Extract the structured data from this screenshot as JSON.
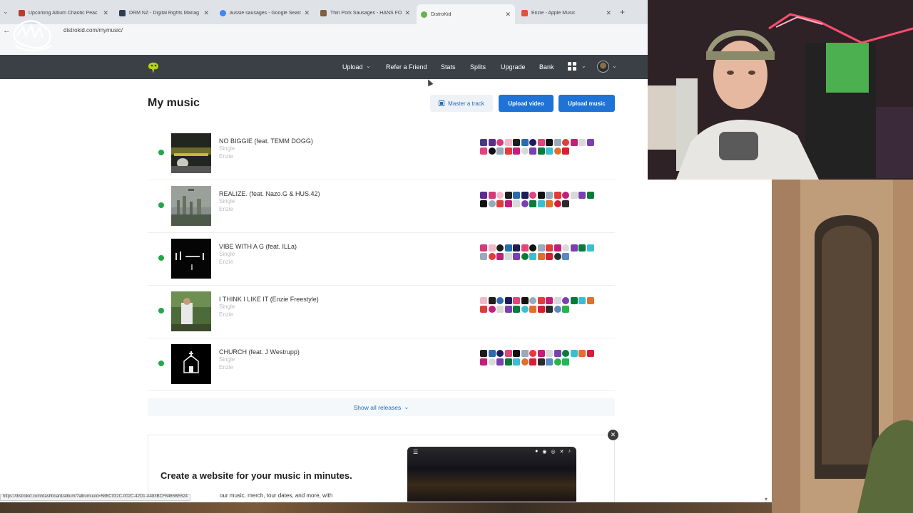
{
  "browser": {
    "tabs": [
      {
        "title": "Upcoming Album Chaotic Peac",
        "color": "#c0392b"
      },
      {
        "title": "DRM NZ - Digital Rights Manag",
        "color": "#2c3e50"
      },
      {
        "title": "aussie sausages - Google Searc",
        "color": "#4285f4"
      },
      {
        "title": "Thin Pork Sausages - HANS FO",
        "color": "#7f5f3f"
      },
      {
        "title": "DistroKid",
        "color": "#6ab04c"
      },
      {
        "title": "Enzie - Apple Music",
        "color": "#e74c3c"
      }
    ],
    "url": "distrokid.com/mymusic/",
    "status_url": "https://distrokid.com/dashboard/album/?albumuuid=58BC032C-002C-42D1-A483BCF8465BE624"
  },
  "nav": {
    "items": [
      "Upload",
      "Refer a Friend",
      "Stats",
      "Splits",
      "Upgrade",
      "Bank"
    ]
  },
  "main": {
    "title": "My music",
    "master_label": "Master a track",
    "upload_video_label": "Upload video",
    "upload_music_label": "Upload music",
    "show_all_label": "Show all releases",
    "releases": [
      {
        "title": "NO BIGGIE (feat. TEMM DOGG)",
        "type": "Single",
        "artist": "Enzie"
      },
      {
        "title": "REALIZE. (feat. Nazo.G & HUS.42)",
        "type": "Single",
        "artist": "Enzie"
      },
      {
        "title": "VIBE WITH A G (feat. ILLa)",
        "type": "Single",
        "artist": "Enzie"
      },
      {
        "title": "I THINK I LIKE IT (Enzie Freestyle)",
        "type": "Single",
        "artist": "Enzie"
      },
      {
        "title": "CHURCH (feat. J Westrupp)",
        "type": "Single",
        "artist": "Enzie"
      }
    ]
  },
  "promo": {
    "title": "Create a website for your music in minutes.",
    "body": "our music, merch, tour dates, and more, with"
  },
  "colors": {
    "accent": "#1f73d6",
    "status_green": "#22a74a",
    "nav_bg": "#3a4046"
  }
}
